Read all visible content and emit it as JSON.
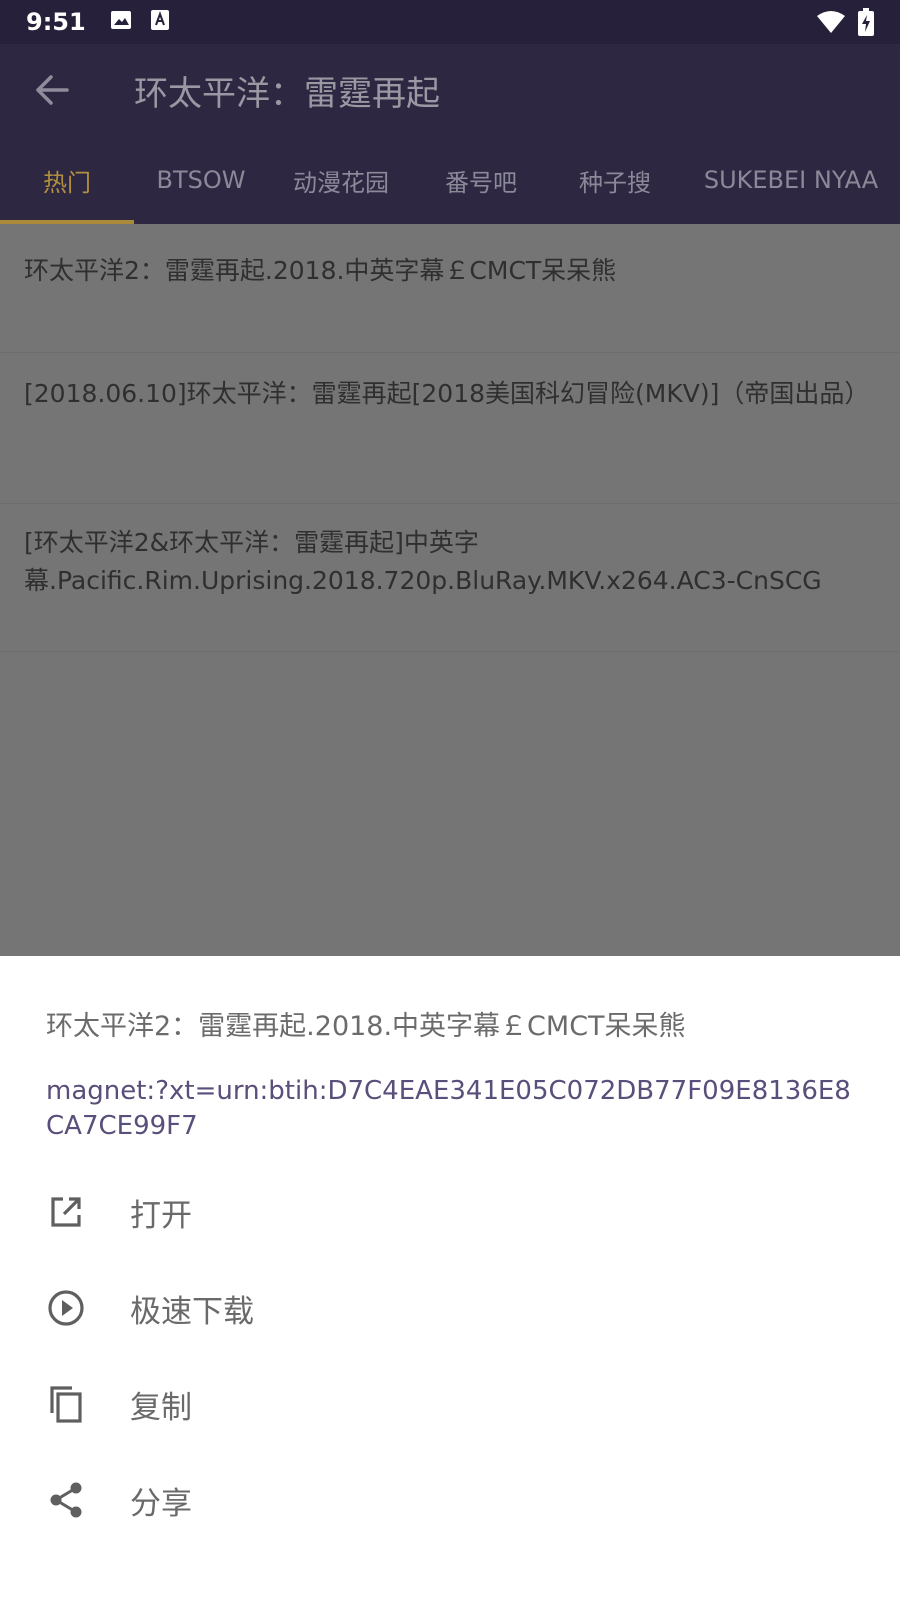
{
  "status": {
    "time": "9:51",
    "icons_left": [
      "image-icon",
      "font-icon"
    ],
    "icons_right": [
      "wifi-icon",
      "battery-charging-icon"
    ]
  },
  "app_bar": {
    "title": "环太平洋：雷霆再起"
  },
  "tabs": [
    {
      "label": "热门",
      "active": true
    },
    {
      "label": "BTSOW",
      "active": false
    },
    {
      "label": "动漫花园",
      "active": false
    },
    {
      "label": "番号吧",
      "active": false
    },
    {
      "label": "种子搜",
      "active": false
    },
    {
      "label": "SUKEBEI NYAA",
      "active": false
    }
  ],
  "results": [
    {
      "title": "环太平洋2：雷霆再起.2018.中英字幕￡CMCT呆呆熊"
    },
    {
      "title": "[2018.06.10]环太平洋：雷霆再起[2018美国科幻冒险(MKV)]（帝国出品）"
    },
    {
      "title": "[环太平洋2&环太平洋：雷霆再起]中英字幕.Pacific.Rim.Uprising.2018.720p.BluRay.MKV.x264.AC3-CnSCG"
    }
  ],
  "sheet": {
    "title": "环太平洋2：雷霆再起.2018.中英字幕￡CMCT呆呆熊",
    "magnet": "magnet:?xt=urn:btih:D7C4EAE341E05C072DB77F09E8136E8CA7CE99F7",
    "actions": [
      {
        "label": "打开",
        "icon": "open-in-new-icon"
      },
      {
        "label": "极速下载",
        "icon": "play-circle-icon"
      },
      {
        "label": "复制",
        "icon": "copy-icon"
      },
      {
        "label": "分享",
        "icon": "share-icon"
      }
    ]
  }
}
